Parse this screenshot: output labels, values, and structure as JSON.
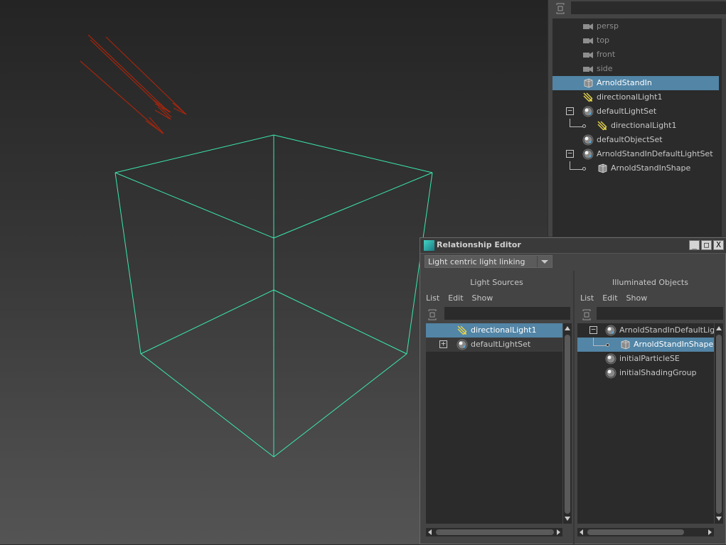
{
  "outliner": {
    "items": [
      {
        "label": "persp",
        "icon": "camera-icon",
        "dim": true
      },
      {
        "label": "top",
        "icon": "camera-icon",
        "dim": true
      },
      {
        "label": "front",
        "icon": "camera-icon",
        "dim": true
      },
      {
        "label": "side",
        "icon": "camera-icon",
        "dim": true
      },
      {
        "label": "ArnoldStandIn",
        "icon": "standin-icon",
        "selected": true
      },
      {
        "label": "directionalLight1",
        "icon": "directional-light-icon"
      },
      {
        "label": "defaultLightSet",
        "icon": "set-icon",
        "expanded": true
      },
      {
        "label": "directionalLight1",
        "icon": "directional-light-icon",
        "child": true
      },
      {
        "label": "defaultObjectSet",
        "icon": "set-icon"
      },
      {
        "label": "ArnoldStandInDefaultLightSet",
        "icon": "set-icon",
        "expanded": true
      },
      {
        "label": "ArnoldStandInShape",
        "icon": "standin-shape-icon",
        "child": true
      }
    ]
  },
  "relationship_editor": {
    "title": "Relationship Editor",
    "window_buttons": {
      "minimize": "_",
      "maximize": "□",
      "close": "X"
    },
    "mode": "Light centric light linking",
    "left_panel": {
      "title": "Light Sources",
      "menu": [
        "List",
        "Edit",
        "Show"
      ],
      "items": [
        {
          "label": "directionalLight1",
          "icon": "directional-light-icon",
          "selected": true
        },
        {
          "label": "defaultLightSet",
          "icon": "set-icon",
          "expander": "+"
        }
      ]
    },
    "right_panel": {
      "title": "Illuminated Objects",
      "menu": [
        "List",
        "Edit",
        "Show"
      ],
      "items": [
        {
          "label": "ArnoldStandInDefaultLig",
          "icon": "set-icon",
          "expander": "−"
        },
        {
          "label": "ArnoldStandInShape",
          "icon": "standin-shape-icon",
          "selected": true,
          "child": true
        },
        {
          "label": "initialParticleSE",
          "icon": "shading-group-icon"
        },
        {
          "label": "initialShadingGroup",
          "icon": "shading-group-icon"
        }
      ]
    }
  },
  "colors": {
    "selection": "#5285a6",
    "wireframe": "#3ae8b0",
    "light_gizmo": "#a2260e",
    "panel_bg": "#444444",
    "list_bg": "#2b2b2b"
  }
}
